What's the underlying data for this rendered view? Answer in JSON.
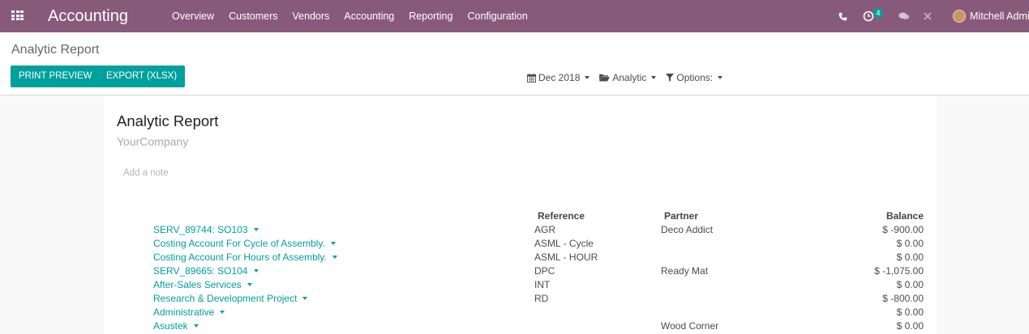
{
  "navbar": {
    "app_title": "Accounting",
    "menu": [
      "Overview",
      "Customers",
      "Vendors",
      "Accounting",
      "Reporting",
      "Configuration"
    ],
    "activity_count": "4",
    "user_name": "Mitchell Admin",
    "brand_color": "#875a7b"
  },
  "control_panel": {
    "breadcrumb": "Analytic Report",
    "print_label": "PRINT PREVIEW",
    "export_label": "EXPORT (XLSX)",
    "filters": {
      "date": "Dec 2018",
      "analytic": "Analytic",
      "options": "Options:"
    },
    "accent_color": "#00a09d"
  },
  "report": {
    "title": "Analytic Report",
    "company": "YourCompany",
    "note_placeholder": "Add a note",
    "headers": {
      "reference": "Reference",
      "partner": "Partner",
      "balance": "Balance"
    },
    "rows": [
      {
        "account": "SERV_89744: SO103",
        "reference": "AGR",
        "partner": "Deco Addict",
        "balance": "$ -900.00"
      },
      {
        "account": "Costing Account For Cycle of Assembly.",
        "reference": "ASML - Cycle",
        "partner": "",
        "balance": "$ 0.00"
      },
      {
        "account": "Costing Account For Hours of Assembly.",
        "reference": "ASML - HOUR",
        "partner": "",
        "balance": "$ 0.00"
      },
      {
        "account": "SERV_89665: SO104",
        "reference": "DPC",
        "partner": "Ready Mat",
        "balance": "$ -1,075.00"
      },
      {
        "account": "After-Sales Services",
        "reference": "INT",
        "partner": "",
        "balance": "$ 0.00"
      },
      {
        "account": "Research & Development Project",
        "reference": "RD",
        "partner": "",
        "balance": "$ -800.00"
      },
      {
        "account": "Administrative",
        "reference": "",
        "partner": "",
        "balance": "$ 0.00"
      },
      {
        "account": "Asustek",
        "reference": "",
        "partner": "Wood Corner",
        "balance": "$ 0.00"
      }
    ]
  }
}
